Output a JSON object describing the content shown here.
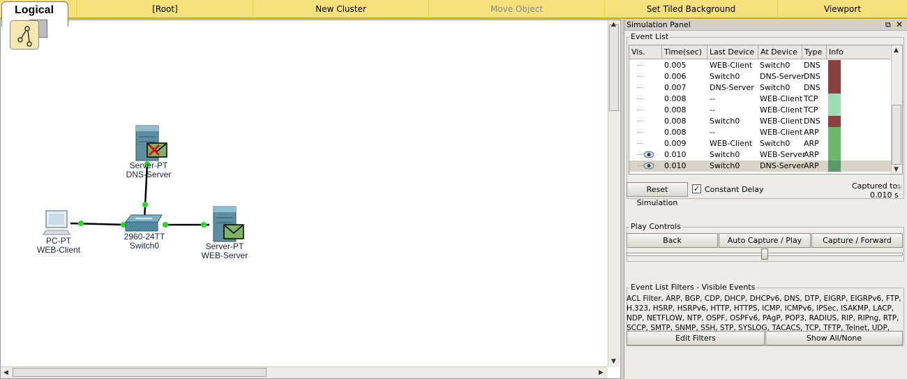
{
  "topbar": {
    "logical_label": "Logical",
    "root_label": "[Root]",
    "new_cluster_label": "New Cluster",
    "move_object_label": "Move Object",
    "set_tiled_bg_label": "Set Tiled Background",
    "viewport_label": "Viewport"
  },
  "workspace": {
    "devices": [
      {
        "type": "Server-PT",
        "name": "DNS-Server",
        "icon": "server-icon"
      },
      {
        "type": "PC-PT",
        "name": "WEB-Client",
        "icon": "pc-icon"
      },
      {
        "type": "2960-24TT",
        "name": "Switch0",
        "icon": "switch-icon"
      },
      {
        "type": "Server-PT",
        "name": "WEB-Server",
        "icon": "server-icon"
      }
    ],
    "link_color": "#000000",
    "port_status_color": "#22dd22"
  },
  "simulation_panel": {
    "title": "Simulation Panel",
    "event_list_label": "Event List",
    "columns": [
      "Vis.",
      "Time(sec)",
      "Last Device",
      "At Device",
      "Type",
      "Info"
    ],
    "events": [
      {
        "time": "0.005",
        "last": "WEB-Client",
        "at": "Switch0",
        "type": "DNS",
        "color": "#8b3f3f",
        "visible": false
      },
      {
        "time": "0.006",
        "last": "Switch0",
        "at": "DNS-Server",
        "type": "DNS",
        "color": "#8b3f3f",
        "visible": false
      },
      {
        "time": "0.007",
        "last": "DNS-Server",
        "at": "Switch0",
        "type": "DNS",
        "color": "#8b3f3f",
        "visible": false
      },
      {
        "time": "0.008",
        "last": "--",
        "at": "WEB-Client",
        "type": "TCP",
        "color": "#9fdcb5",
        "visible": false
      },
      {
        "time": "0.008",
        "last": "--",
        "at": "WEB-Client",
        "type": "TCP",
        "color": "#9fdcb5",
        "visible": false
      },
      {
        "time": "0.008",
        "last": "Switch0",
        "at": "WEB-Client",
        "type": "DNS",
        "color": "#8b3f3f",
        "visible": false
      },
      {
        "time": "0.008",
        "last": "--",
        "at": "WEB-Client",
        "type": "ARP",
        "color": "#6cb96c",
        "visible": false
      },
      {
        "time": "0.009",
        "last": "WEB-Client",
        "at": "Switch0",
        "type": "ARP",
        "color": "#6cb96c",
        "visible": false
      },
      {
        "time": "0.010",
        "last": "Switch0",
        "at": "WEB-Server",
        "type": "ARP",
        "color": "#6cb96c",
        "visible": true
      },
      {
        "time": "0.010",
        "last": "Switch0",
        "at": "DNS-Server",
        "type": "ARP",
        "color": "#5a9a6a",
        "visible": true,
        "selected": true
      }
    ],
    "reset_simulation_label": "Reset Simulation",
    "constant_delay_label": "Constant Delay",
    "constant_delay_checked": true,
    "captured_to_label": "Captured to:",
    "captured_to_value": "0.010 s",
    "play_controls_label": "Play Controls",
    "back_label": "Back",
    "auto_capture_label": "Auto Capture / Play",
    "capture_forward_label": "Capture / Forward",
    "filters_label": "Event List Filters - Visible Events",
    "filters_text": "ACL Filter, ARP, BGP, CDP, DHCP, DHCPv6, DNS, DTP, EIGRP, EIGRPv6, FTP, H.323, HSRP, HSRPv6, HTTP, HTTPS, ICMP, ICMPv6, IPSec, ISAKMP, LACP, NDP, NETFLOW, NTP, OSPF, OSPFv6, PAgP, POP3, RADIUS, RIP, RIPng, RTP, SCCP, SMTP, SNMP, SSH, STP, SYSLOG, TACACS, TCP, TFTP, Telnet, UDP, VTP",
    "edit_filters_label": "Edit Filters",
    "show_all_label": "Show All/None"
  }
}
